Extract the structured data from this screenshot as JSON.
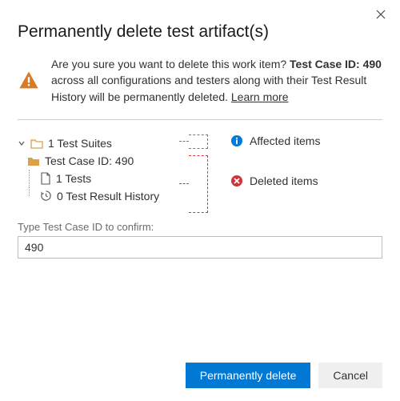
{
  "dialog": {
    "title": "Permanently delete test artifact(s)"
  },
  "warning": {
    "prefix": "Are you sure you want to delete this work item? ",
    "bold": "Test Case ID: 490",
    "suffix": " across all configurations and testers along with their Test Result History will be permanently deleted. ",
    "learn_more": "Learn more"
  },
  "tree": {
    "suites_label": "1 Test Suites",
    "case_label": "Test Case ID: 490",
    "tests_label": "1 Tests",
    "history_label": "0 Test Result History"
  },
  "legend": {
    "affected": "Affected items",
    "deleted": "Deleted items"
  },
  "confirm": {
    "label": "Type Test Case ID to confirm:",
    "value": "490"
  },
  "buttons": {
    "primary": "Permanently delete",
    "secondary": "Cancel"
  },
  "colors": {
    "primary": "#0078d4",
    "warning": "#d77b29",
    "danger": "#d13438",
    "info": "#0078d4",
    "folder": "#dca04a"
  }
}
